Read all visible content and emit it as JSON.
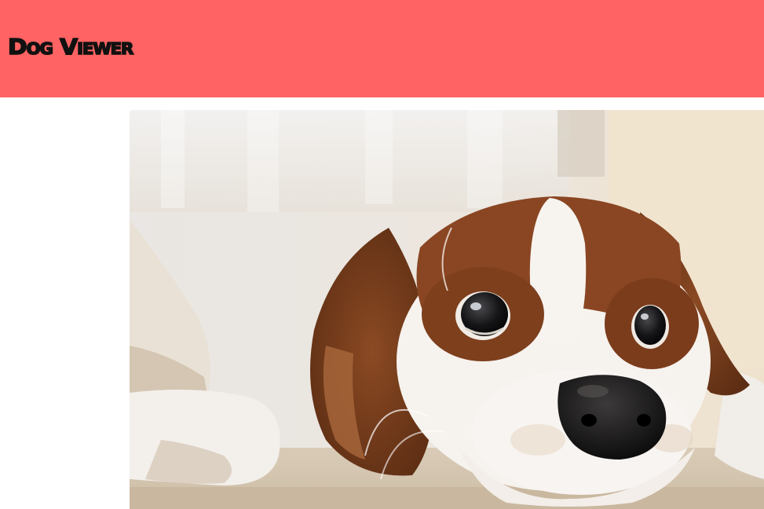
{
  "app": {
    "title": "Dog Viewer"
  },
  "theme": {
    "header_color": "#ff6363",
    "title_color": "#111111"
  },
  "photo": {
    "subject": "dog-photo"
  }
}
